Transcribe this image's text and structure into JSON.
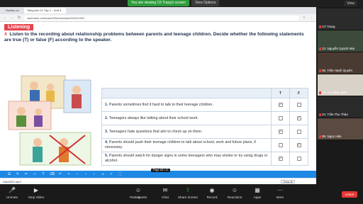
{
  "zoom": {
    "viewing_banner": "You are viewing Cô Trang's screen",
    "view_options": "View Options",
    "view_button": "View",
    "bottom": {
      "unmute": "Unmute",
      "stop_video": "Stop Video",
      "participants": "Participants",
      "participants_count": "25",
      "chat": "Chat",
      "share_screen": "Share Screen",
      "record": "Record",
      "reactions": "Reactions",
      "apps": "Apps",
      "more": "More",
      "leave": "Leave"
    }
  },
  "browser": {
    "tabs": [
      "Hoclieu.vn",
      "Tiếng Anh 11 Tập 1 - Unit 3..."
    ],
    "url": "sachmem.vn/books/220/exercises/34/10/1001"
  },
  "content": {
    "tag": "Listening",
    "instruction_number": "4",
    "instruction": "Listen to the recording about relationship problems between parents and teenage children. Decide whether the following statements are true (T) or false (F) according to the speaker.",
    "table": {
      "headers": [
        "",
        "T",
        "F"
      ],
      "rows": [
        {
          "num": "1.",
          "text": "Parents sometimes find it hard to talk to their teenage children.",
          "t": true,
          "f": false
        },
        {
          "num": "2.",
          "text": "Teenagers always like talking about their school work.",
          "t": false,
          "f": true
        },
        {
          "num": "3.",
          "text": "Teenagers hate questions that aim to check up on them.",
          "t": true,
          "f": false
        },
        {
          "num": "4.",
          "text": "Parents should push their teenage children to talk about school, work and future plans, if necessary.",
          "t": false,
          "f": true
        },
        {
          "num": "5.",
          "text": "Parents should watch for danger signs in some teenagers who may smoke or try using drugs or alcohol.",
          "t": true,
          "f": false
        }
      ]
    }
  },
  "page_label": "Page 4/6 • 11",
  "status": {
    "file": "Zalo2022.mp3",
    "show_all": "Show all"
  },
  "participants": [
    {
      "name": "Cô Trang"
    },
    {
      "name": "12. Nguyễn Quỳnh Mai"
    },
    {
      "name": "06. Trần Hạnh Quyên"
    },
    {
      "name": "15. Lê Hồng Minh"
    },
    {
      "name": "24. Trần Thu Thảo"
    },
    {
      "name": "08. Ngọc Hân"
    }
  ]
}
